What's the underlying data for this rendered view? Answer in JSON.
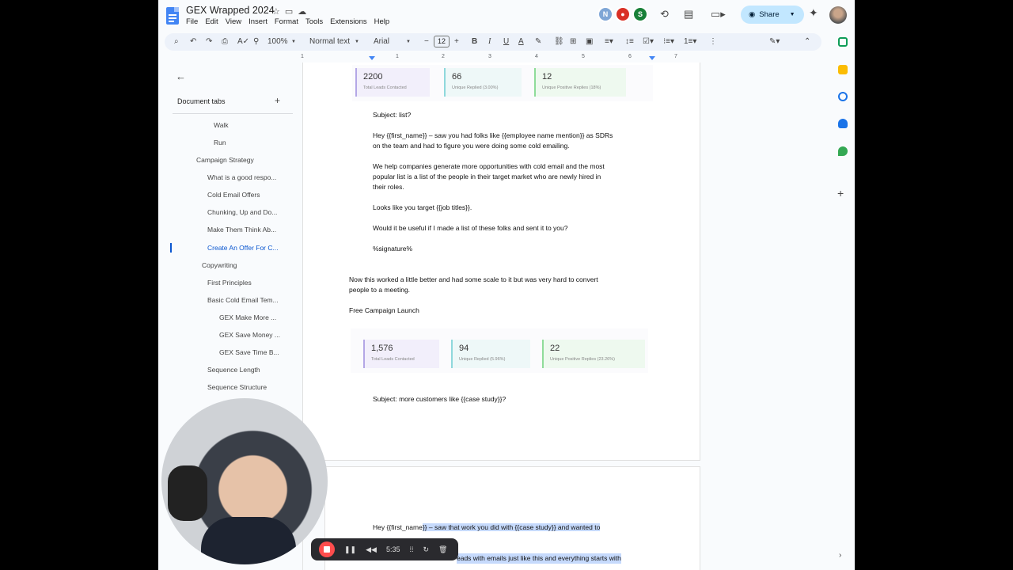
{
  "doc": {
    "title": "GEX Wrapped 2024"
  },
  "menu": [
    "File",
    "Edit",
    "View",
    "Insert",
    "Format",
    "Tools",
    "Extensions",
    "Help"
  ],
  "toolbar": {
    "zoom": "100%",
    "style": "Normal text",
    "font": "Arial",
    "size": "12"
  },
  "header": {
    "share_label": "Share",
    "avatars": [
      "N",
      "",
      ""
    ]
  },
  "ruler": [
    "1",
    "1",
    "2",
    "3",
    "4",
    "5",
    "6",
    "7"
  ],
  "sidebar": {
    "tabs_label": "Document tabs",
    "outline": [
      {
        "label": "Walk"
      },
      {
        "label": "Run"
      },
      {
        "label": "Campaign Strategy"
      },
      {
        "label": "What is a good respo..."
      },
      {
        "label": "Cold Email Offers"
      },
      {
        "label": "Chunking, Up and Do..."
      },
      {
        "label": "Make Them Think Ab..."
      },
      {
        "label": "Create An Offer For C..."
      },
      {
        "label": "Copywriting"
      },
      {
        "label": "First Principles"
      },
      {
        "label": "Basic Cold Email Tem..."
      },
      {
        "label": "GEX Make More ..."
      },
      {
        "label": "GEX Save Money ..."
      },
      {
        "label": "GEX Save Time B..."
      },
      {
        "label": "Sequence Length"
      },
      {
        "label": "Sequence Structure"
      }
    ]
  },
  "stats1": [
    {
      "value": "2200",
      "label": "Total Leads Contacted",
      "color": "#b4a7e6"
    },
    {
      "value": "66",
      "label": "Unique Replied (3.00%)",
      "color": "#8fd8dc"
    },
    {
      "value": "12",
      "label": "Unique Positive Replies (18%)",
      "color": "#8fdc9a"
    }
  ],
  "stats2": [
    {
      "value": "1,576",
      "label": "Total Leads Contacted",
      "color": "#b4a7e6"
    },
    {
      "value": "94",
      "label": "Unique Replied (5.96%)",
      "color": "#8fd8dc"
    },
    {
      "value": "22",
      "label": "Unique Positive Replies (23.26%)",
      "color": "#8fdc9a"
    }
  ],
  "body": {
    "subject1": "Subject: list?",
    "p1a": "Hey {{first_name}} – saw you had folks like {{employee name mention}} as SDRs",
    "p1b": "on the team and had to figure you were doing some cold emailing.",
    "p2a": "We help companies generate more opportunities with cold email and the most",
    "p2b": "popular list is a list of the people in their target market who are newly hired in",
    "p2c": "their roles.",
    "p3": "Looks like you target {{job titles}}.",
    "p4": "Would it be useful if I made a list of these folks and sent it to you?",
    "sig": "%signature%",
    "p5a": "Now this worked a little better and had some scale to it but was very hard to convert",
    "p5b": "people to a meeting.",
    "launch": "Free Campaign Launch",
    "subject2": "Subject: more customers like {{case study}}?",
    "p6_plain": "Hey {{first_name",
    "p6_hl": "}} – saw that work you did with {{case study}} and wanted to",
    "p7": "eads with emails just like this and everything starts with"
  },
  "recorder": {
    "time": "5:35"
  }
}
